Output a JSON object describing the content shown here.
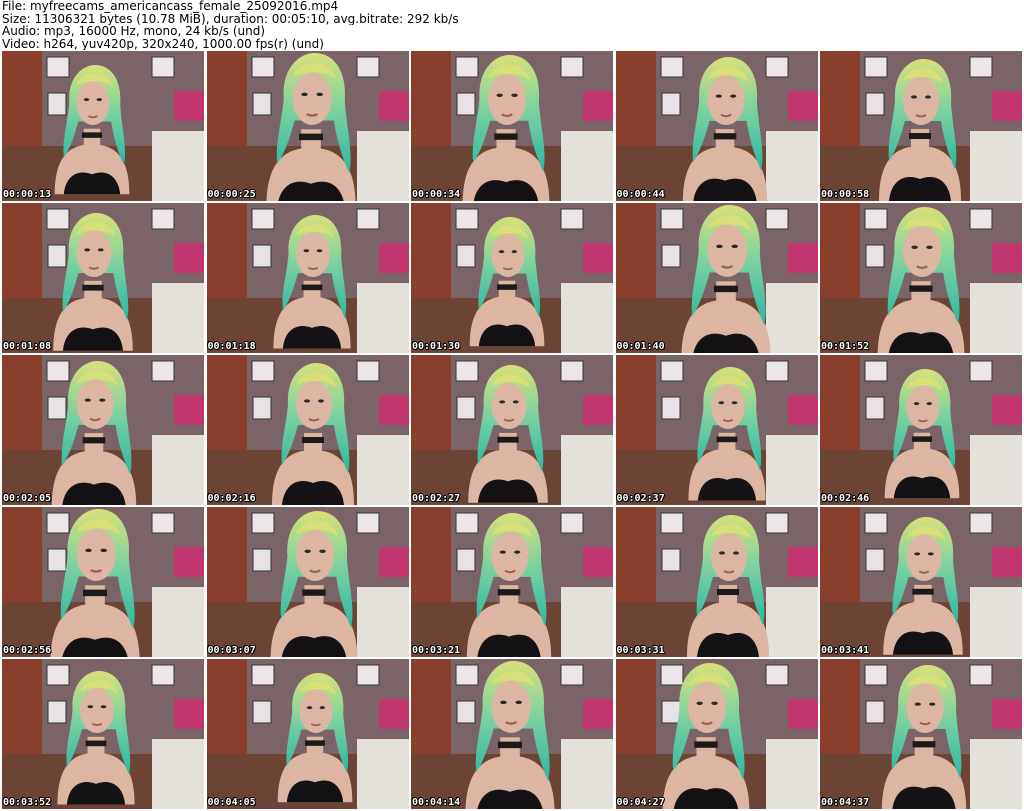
{
  "header": {
    "file": "File: myfreecams_americancass_female_25092016.mp4",
    "size": "Size: 11306321 bytes (10.78 MiB), duration: 00:05:10, avg.bitrate: 292 kb/s",
    "audio": "Audio: mp3, 16000 Hz, mono, 24 kb/s (und)",
    "video": "Video: h264, yuv420p, 320x240, 1000.00 fps(r) (und)"
  },
  "thumbnails": [
    {
      "time": "00:00:13"
    },
    {
      "time": "00:00:25"
    },
    {
      "time": "00:00:34"
    },
    {
      "time": "00:00:44"
    },
    {
      "time": "00:00:58"
    },
    {
      "time": "00:01:08"
    },
    {
      "time": "00:01:18"
    },
    {
      "time": "00:01:30"
    },
    {
      "time": "00:01:40"
    },
    {
      "time": "00:01:52"
    },
    {
      "time": "00:02:05"
    },
    {
      "time": "00:02:16"
    },
    {
      "time": "00:02:27"
    },
    {
      "time": "00:02:37"
    },
    {
      "time": "00:02:46"
    },
    {
      "time": "00:02:56"
    },
    {
      "time": "00:03:07"
    },
    {
      "time": "00:03:21"
    },
    {
      "time": "00:03:31"
    },
    {
      "time": "00:03:41"
    },
    {
      "time": "00:03:52"
    },
    {
      "time": "00:04:05"
    },
    {
      "time": "00:04:14"
    },
    {
      "time": "00:04:27"
    },
    {
      "time": "00:04:37"
    }
  ],
  "colors": {
    "wall": "#7b6468",
    "door": "#8a3f2c",
    "hair_top": "#d9e07a",
    "hair_bottom": "#2bb8a4",
    "skin": "#dcb6a3",
    "top": "#141214",
    "chair": "#e4e0da",
    "pink": "#c0356e"
  }
}
